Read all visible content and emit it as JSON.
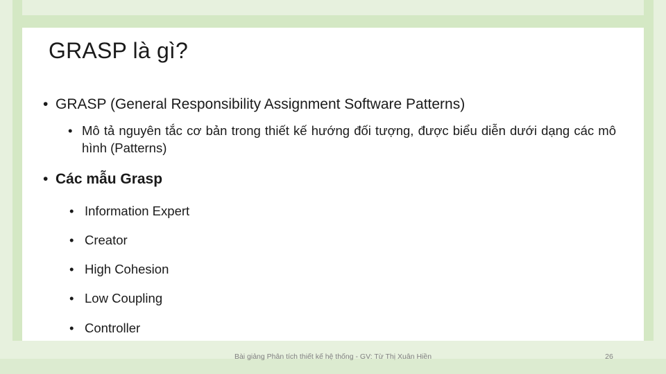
{
  "slide": {
    "title": "GRASP là gì?",
    "bullet_glyph": "•",
    "theme": {
      "frame_outer": "#e7f1de",
      "frame_inner": "#d4e8c4",
      "frame_bottom": "#dcebd0",
      "text": "#1a1a1a",
      "footer_text": "#7f7f7f",
      "background": "#ffffff"
    },
    "body": {
      "item1": "GRASP (General Responsibility Assignment Software Patterns)",
      "item1_sub": "Mô tả nguyên tắc cơ bản trong thiết kế hướng đối tượng, được biểu diễn dưới dạng các mô hình (Patterns)",
      "item2": "Các mẫu Grasp",
      "item2_subs": [
        "Information Expert",
        "Creator",
        "High Cohesion",
        "Low Coupling",
        "Controller"
      ]
    },
    "footer": {
      "text": "Bài giảng Phân tích thiết kế hệ thống - GV: Từ Thị Xuân Hiền",
      "page_number": "26"
    }
  }
}
